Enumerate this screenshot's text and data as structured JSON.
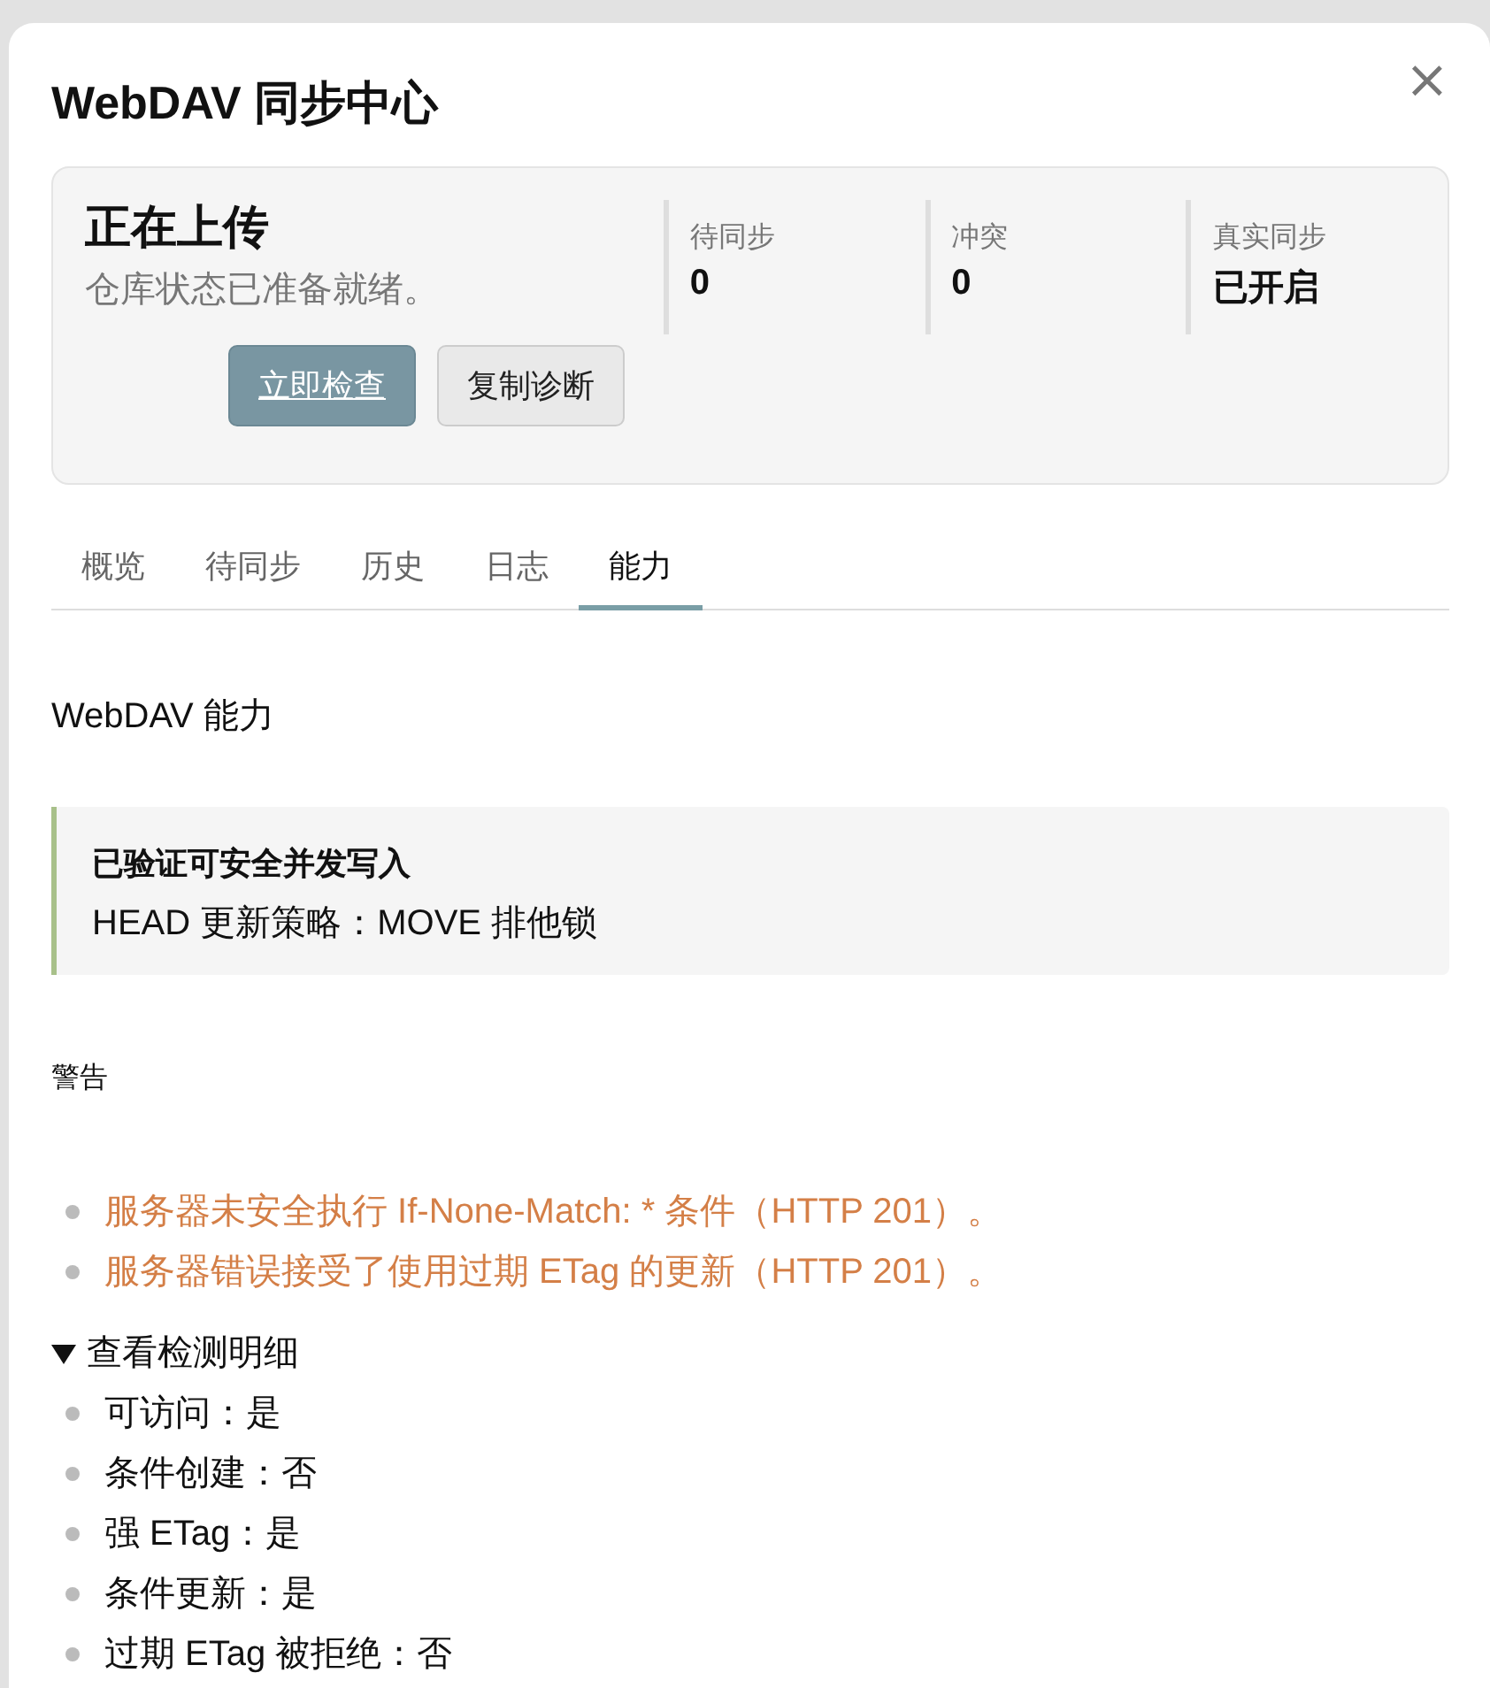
{
  "dialog": {
    "title": "WebDAV 同步中心",
    "close": "×"
  },
  "status": {
    "title": "正在上传",
    "subtitle": "仓库状态已准备就绪。",
    "stats": [
      {
        "label": "待同步",
        "value": "0"
      },
      {
        "label": "冲突",
        "value": "0"
      },
      {
        "label": "真实同步",
        "value": "已开启"
      }
    ],
    "buttons": [
      {
        "label": "立即检查",
        "kind": "primary"
      },
      {
        "label": "复制诊断",
        "kind": "secondary"
      }
    ]
  },
  "tabs": [
    {
      "label": "概览",
      "selected": false
    },
    {
      "label": "待同步",
      "selected": false
    },
    {
      "label": "历史",
      "selected": false
    },
    {
      "label": "日志",
      "selected": false
    },
    {
      "label": "能力",
      "selected": true
    }
  ],
  "section_title": "WebDAV 能力",
  "callout": {
    "title": "已验证可安全并发写入",
    "text": "HEAD 更新策略：MOVE 排他锁"
  },
  "warnings_title": "警告",
  "warnings": [
    "服务器未安全执行 If-None-Match: * 条件（HTTP 201）。",
    "服务器错误接受了使用过期 ETag 的更新（HTTP 201）。"
  ],
  "details": {
    "summary": "查看检测明细",
    "expanded": true,
    "items": [
      "可访问：是",
      "条件创建：否",
      "强 ETag：是",
      "条件更新：是",
      "过期 ETag 被拒绝：否"
    ]
  }
}
